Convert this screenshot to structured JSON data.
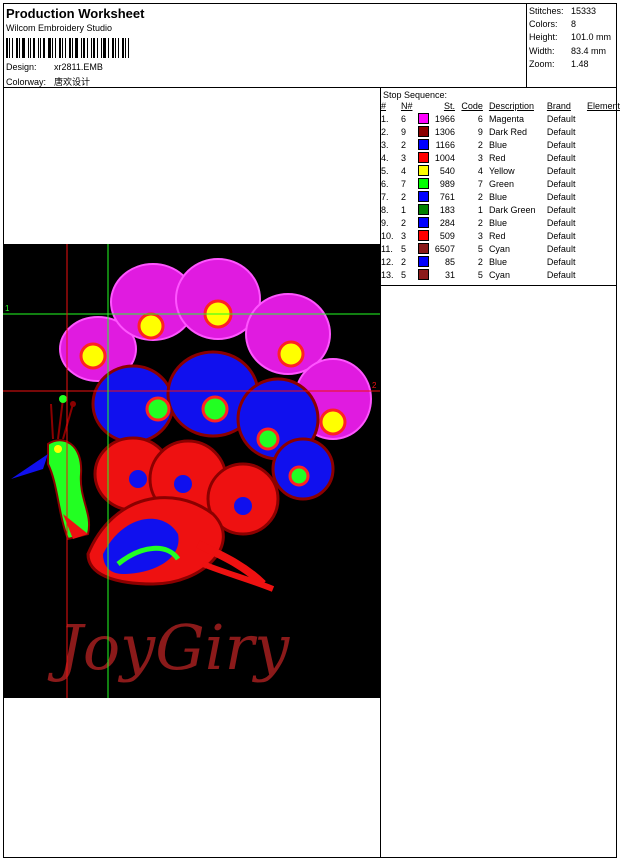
{
  "header": {
    "title": "Production Worksheet",
    "software": "Wilcom Embroidery Studio",
    "design_label": "Design:",
    "design_value": "xr2811.EMB",
    "colorway_label": "Colorway:",
    "colorway_value": "唐欢设计"
  },
  "stats": [
    {
      "label": "Stitches:",
      "value": "15333"
    },
    {
      "label": "Colors:",
      "value": "8"
    },
    {
      "label": "Height:",
      "value": "101.0 mm"
    },
    {
      "label": "Width:",
      "value": "83.4 mm"
    },
    {
      "label": "Zoom:",
      "value": "1.48"
    }
  ],
  "sequence": {
    "title": "Stop Sequence:",
    "headers": {
      "idx": "#",
      "n": "N#",
      "st": "St.",
      "code": "Code",
      "desc": "Description",
      "brand": "Brand",
      "element": "Element"
    },
    "rows": [
      {
        "idx": "1.",
        "n": "6",
        "color": "#ff00ff",
        "st": "1966",
        "code": "6",
        "desc": "Magenta",
        "brand": "Default"
      },
      {
        "idx": "2.",
        "n": "9",
        "color": "#8b0000",
        "st": "1306",
        "code": "9",
        "desc": "Dark Red",
        "brand": "Default"
      },
      {
        "idx": "3.",
        "n": "2",
        "color": "#0000ff",
        "st": "1166",
        "code": "2",
        "desc": "Blue",
        "brand": "Default"
      },
      {
        "idx": "4.",
        "n": "3",
        "color": "#ff0000",
        "st": "1004",
        "code": "3",
        "desc": "Red",
        "brand": "Default"
      },
      {
        "idx": "5.",
        "n": "4",
        "color": "#ffff00",
        "st": "540",
        "code": "4",
        "desc": "Yellow",
        "brand": "Default"
      },
      {
        "idx": "6.",
        "n": "7",
        "color": "#00ff00",
        "st": "989",
        "code": "7",
        "desc": "Green",
        "brand": "Default"
      },
      {
        "idx": "7.",
        "n": "2",
        "color": "#0000ff",
        "st": "761",
        "code": "2",
        "desc": "Blue",
        "brand": "Default"
      },
      {
        "idx": "8.",
        "n": "1",
        "color": "#008000",
        "st": "183",
        "code": "1",
        "desc": "Dark Green",
        "brand": "Default"
      },
      {
        "idx": "9.",
        "n": "2",
        "color": "#0000ff",
        "st": "284",
        "code": "2",
        "desc": "Blue",
        "brand": "Default"
      },
      {
        "idx": "10.",
        "n": "3",
        "color": "#ff0000",
        "st": "509",
        "code": "3",
        "desc": "Red",
        "brand": "Default"
      },
      {
        "idx": "11.",
        "n": "5",
        "color": "#8b1a1a",
        "st": "6507",
        "code": "5",
        "desc": "Cyan",
        "brand": "Default"
      },
      {
        "idx": "12.",
        "n": "2",
        "color": "#0000ff",
        "st": "85",
        "code": "2",
        "desc": "Blue",
        "brand": "Default"
      },
      {
        "idx": "13.",
        "n": "5",
        "color": "#8b1a1a",
        "st": "31",
        "code": "5",
        "desc": "Cyan",
        "brand": "Default"
      }
    ]
  },
  "design_preview": {
    "text": "JoyGiry",
    "guide_labels": [
      "1",
      "2"
    ]
  }
}
